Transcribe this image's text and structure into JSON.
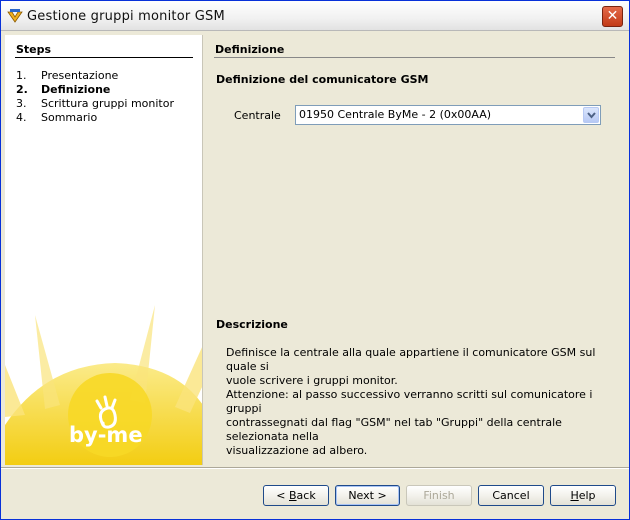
{
  "window": {
    "title": "Gestione gruppi monitor GSM"
  },
  "steps": {
    "title": "Steps",
    "items": [
      {
        "num": "1.",
        "label": "Presentazione"
      },
      {
        "num": "2.",
        "label": "Definizione"
      },
      {
        "num": "3.",
        "label": "Scrittura gruppi monitor"
      },
      {
        "num": "4.",
        "label": "Sommario"
      }
    ],
    "active_index": 1,
    "logo_text": "by-me"
  },
  "main": {
    "section_title": "Definizione",
    "subtitle": "Definizione del comunicatore GSM",
    "centrale_label": "Centrale",
    "centrale_value": "01950 Centrale ByMe - 2 (0x00AA)",
    "description_title": "Descrizione",
    "description_lines": [
      "Definisce la centrale alla quale appartiene il comunicatore GSM sul quale si",
      "vuole scrivere i gruppi monitor.",
      "Attenzione: al passo successivo verranno scritti sul comunicatore i gruppi",
      "contrassegnati dal flag \"GSM\" nel tab \"Gruppi\" della centrale selezionata nella",
      "visualizzazione ad albero."
    ]
  },
  "buttons": {
    "back_prefix": "< ",
    "back_mnemonic": "B",
    "back_rest": "ack",
    "next": "Next >",
    "finish": "Finish",
    "cancel": "Cancel",
    "help_mnemonic": "H",
    "help_rest": "elp"
  },
  "colors": {
    "accent_title_border": "#0831d9",
    "panel_bg": "#ece9d8",
    "sun_yellow": "#f5d21e",
    "close_red": "#c23a16"
  }
}
